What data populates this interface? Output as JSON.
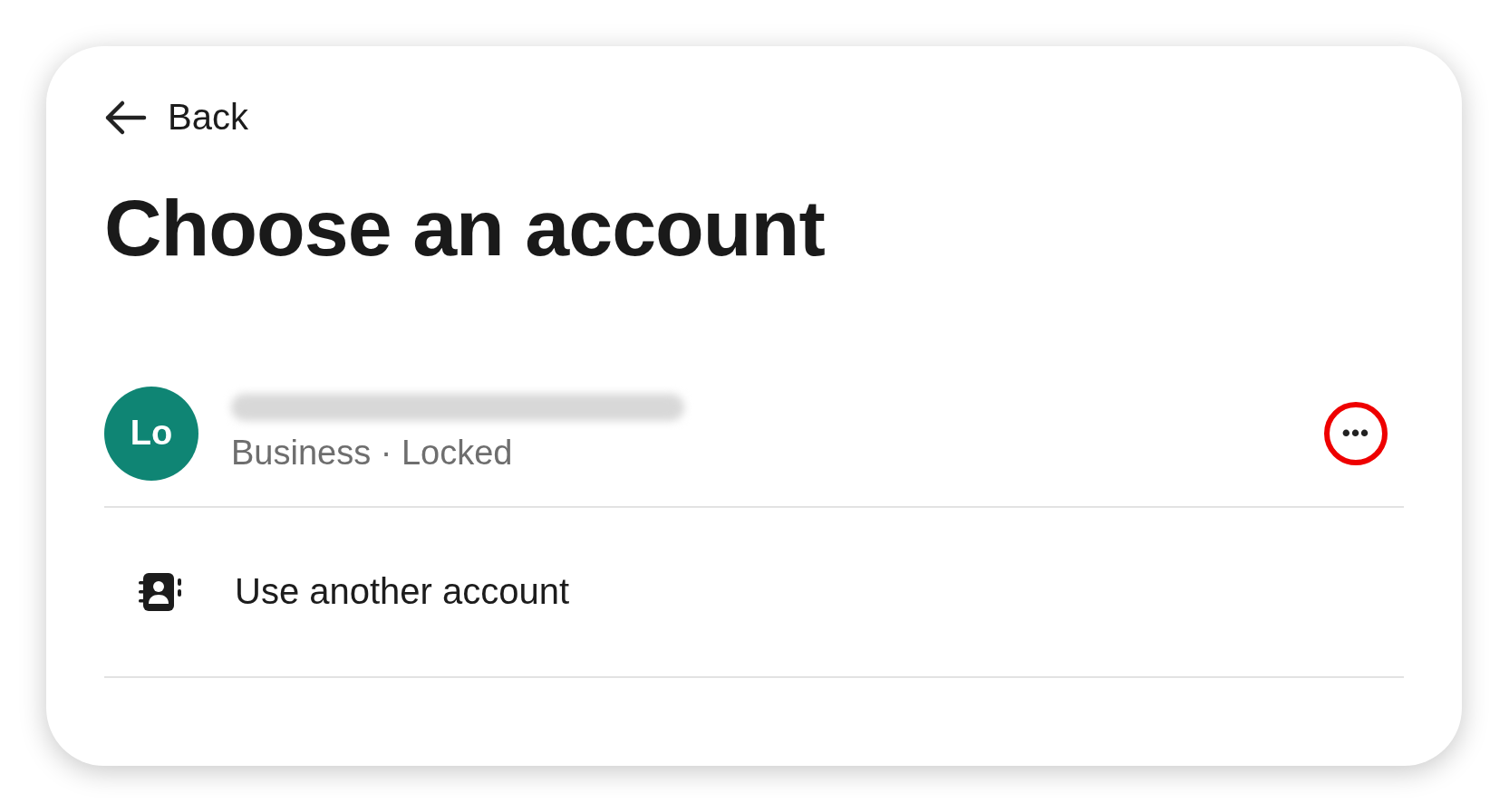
{
  "back": {
    "label": "Back"
  },
  "title": "Choose an account",
  "accounts": [
    {
      "initials": "Lo",
      "color": "#0f8574",
      "email_blurred": true,
      "subtitle": "Business · Locked",
      "more": {
        "label": "•••",
        "highlighted": true
      }
    }
  ],
  "other_account": {
    "label": "Use another account"
  }
}
